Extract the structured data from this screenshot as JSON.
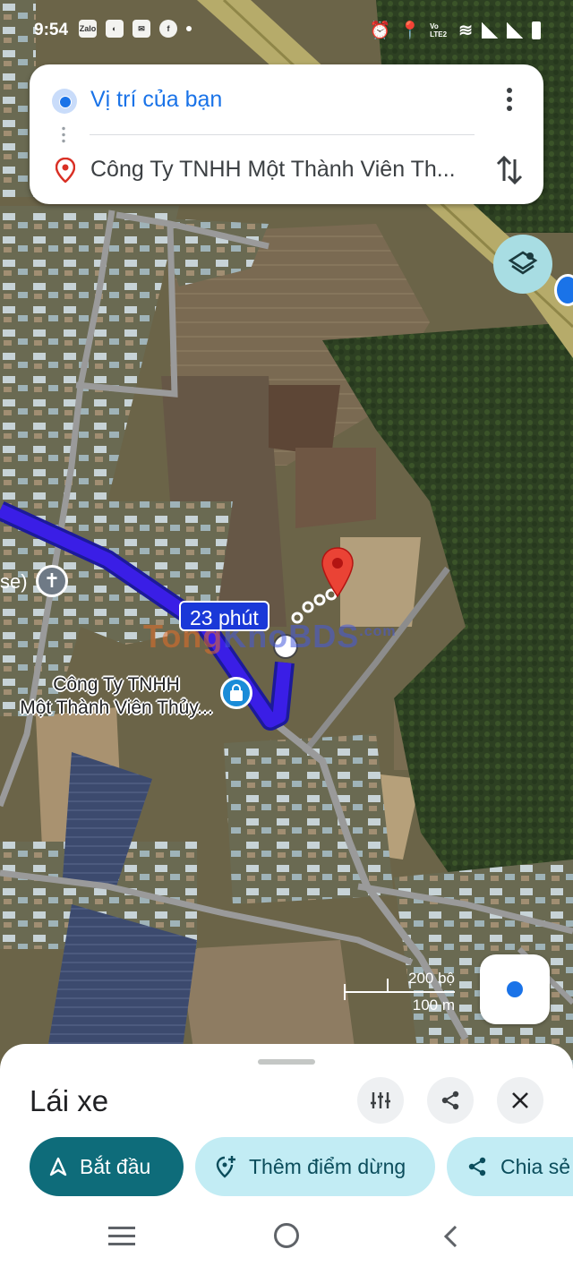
{
  "status_bar": {
    "time": "9:54",
    "left_icons": [
      "zalo-icon",
      "messenger-icon",
      "mail-icon",
      "facebook-icon",
      "dot-icon"
    ],
    "right_icons": [
      "alarm-icon",
      "location-icon",
      "volte-icon",
      "wifi-icon",
      "signal-icon",
      "signal-icon",
      "battery-icon"
    ],
    "volte_label": "Vo LTE2",
    "zalo_label": "Zalo"
  },
  "route": {
    "origin": "Vị trí của bạn",
    "destination": "Công Ty TNHH Một Thành Viên Th..."
  },
  "map": {
    "duration_label": "23 phút",
    "place_label_line1": "Công Ty TNHH",
    "place_label_line2": "Một Thành Viên Thủy...",
    "church_label": "se)",
    "watermark_a": "Tong",
    "watermark_b": "KhoBDS",
    "watermark_sup": ".com",
    "scale_top": "200 bộ",
    "scale_bottom": "100 m",
    "route_color": "#3a1ee6",
    "pin_color": "#ea4335"
  },
  "sheet": {
    "mode_title": "Lái xe",
    "start_label": "Bắt đầu",
    "add_stop_label": "Thêm điểm dừng",
    "share_label": "Chia sẻ",
    "accent_color": "#0e6c7a"
  }
}
